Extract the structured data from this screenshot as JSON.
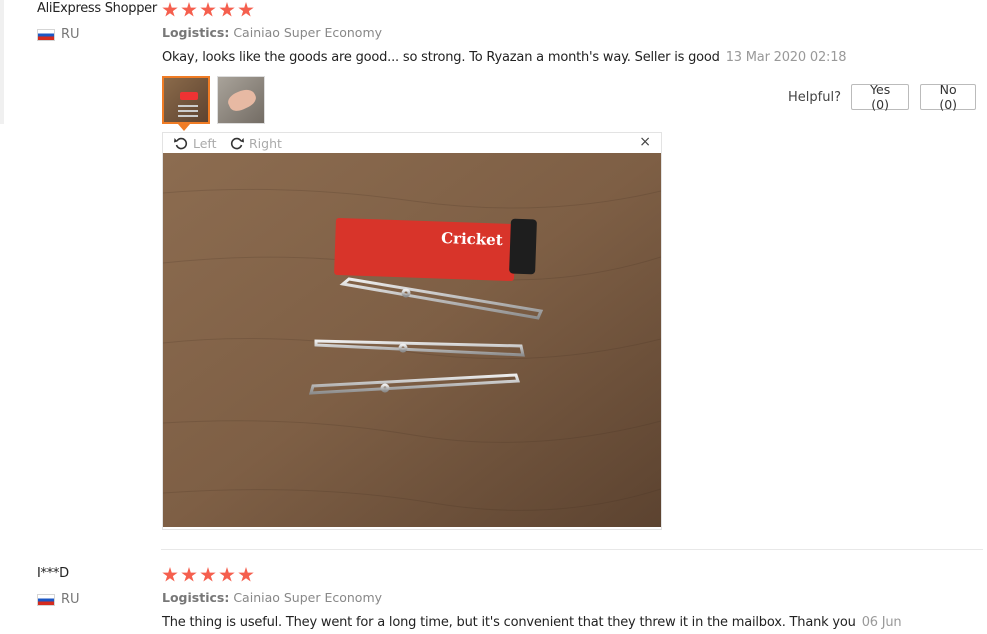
{
  "reviews": [
    {
      "user": "AliExpress Shopper",
      "country": "RU",
      "stars": 5,
      "logistics_label": "Logistics:",
      "logistics_value": "Cainiao Super Economy",
      "text": "Okay, looks like the goods are good... so strong. To Ryazan a month's way. Seller is good",
      "date": "13 Mar 2020 02:18",
      "helpful": {
        "label": "Helpful?",
        "yes": "Yes (0)",
        "no": "No (0)"
      },
      "viewer": {
        "rotate_left": "Left",
        "rotate_right": "Right",
        "close": "×",
        "photo_brand": "Cricket"
      }
    },
    {
      "user": "I***D",
      "country": "RU",
      "stars": 5,
      "logistics_label": "Logistics:",
      "logistics_value": "Cainiao Super Economy",
      "text": "The thing is useful. They went for a long time, but it's convenient that they threw it in the mailbox. Thank you",
      "date": "06 Jun"
    }
  ],
  "colors": {
    "star": "#f55f4e",
    "active_thumb_border": "#f07c25",
    "flag_blue": "#1c57c4",
    "flag_red": "#d52b1e"
  },
  "icons": {
    "rotate_left": "rotate-left-icon",
    "rotate_right": "rotate-right-icon",
    "close": "close-icon",
    "star": "star-icon",
    "flag": "russia-flag-icon"
  }
}
